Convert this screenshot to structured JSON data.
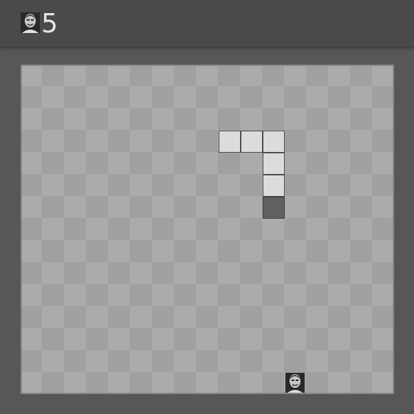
{
  "header": {
    "score": "5",
    "score_icon": "face-photo-icon"
  },
  "game": {
    "grid": {
      "cols": 17,
      "rows": 15
    },
    "snake": [
      {
        "col": 9,
        "row": 3
      },
      {
        "col": 10,
        "row": 3
      },
      {
        "col": 11,
        "row": 3
      },
      {
        "col": 11,
        "row": 4
      },
      {
        "col": 11,
        "row": 5
      },
      {
        "col": 11,
        "row": 6,
        "head": true
      }
    ],
    "food": {
      "col": 12,
      "row": 14,
      "icon": "face-photo-icon"
    },
    "colors": {
      "board_light": "#ababab",
      "board_dark": "#a0a0a0",
      "snake_body": "#dcdcdc",
      "snake_head": "#616161"
    }
  }
}
